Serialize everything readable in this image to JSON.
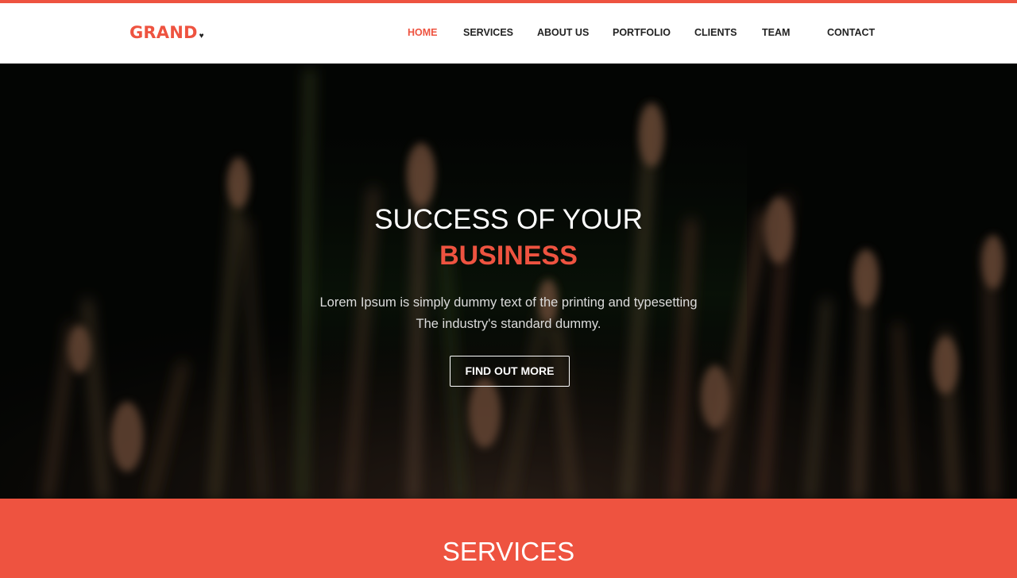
{
  "brand": {
    "name": "GRAND",
    "heart_icon": "heart-icon",
    "accent_color": "#ee5340"
  },
  "nav": {
    "items": [
      {
        "label": "HOME",
        "active": true
      },
      {
        "label": "SERVICES",
        "active": false
      },
      {
        "label": "ABOUT US",
        "active": false
      },
      {
        "label": "PORTFOLIO",
        "active": false
      },
      {
        "label": "CLIENTS",
        "active": false
      },
      {
        "label": "TEAM",
        "active": false
      },
      {
        "label": "CONTACT",
        "active": false
      }
    ]
  },
  "hero": {
    "title": "SUCCESS OF YOUR",
    "highlight": "BUSINESS",
    "description_line1": "Lorem Ipsum is simply dummy text of the printing and typesetting",
    "description_line2": "The industry's standard dummy.",
    "button_label": "FIND OUT MORE",
    "background_colors": [
      "#050705",
      "#5a3a30",
      "#8a7a40"
    ]
  },
  "services": {
    "title": "SERVICES",
    "background_color": "#ee5340"
  }
}
